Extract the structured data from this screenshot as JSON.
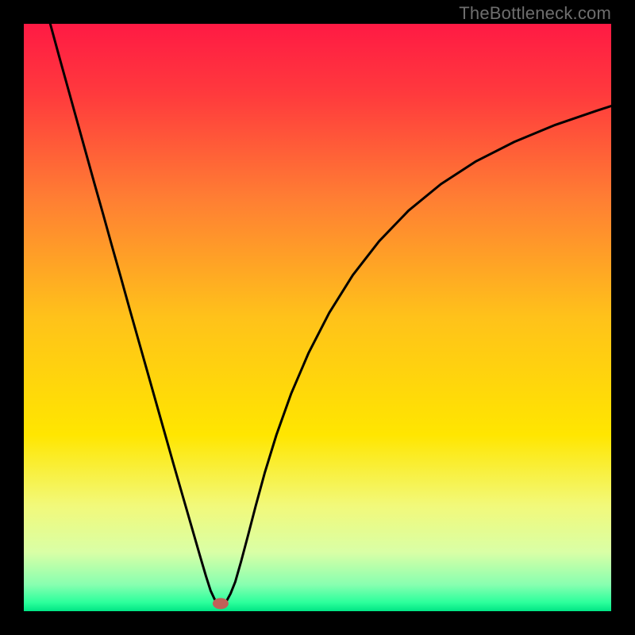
{
  "watermark": "TheBottleneck.com",
  "chart_data": {
    "type": "line",
    "title": "",
    "xlabel": "",
    "ylabel": "",
    "xlim": [
      0,
      1
    ],
    "ylim": [
      0,
      1
    ],
    "grid": false,
    "legend": false,
    "background_gradient": {
      "stops": [
        {
          "pos": 0.0,
          "color": "#ff1a44"
        },
        {
          "pos": 0.12,
          "color": "#ff3a3d"
        },
        {
          "pos": 0.3,
          "color": "#ff7f33"
        },
        {
          "pos": 0.5,
          "color": "#ffc21a"
        },
        {
          "pos": 0.7,
          "color": "#ffe600"
        },
        {
          "pos": 0.82,
          "color": "#f2f97a"
        },
        {
          "pos": 0.9,
          "color": "#d9ffa6"
        },
        {
          "pos": 0.955,
          "color": "#87ffb0"
        },
        {
          "pos": 0.985,
          "color": "#2cff9c"
        },
        {
          "pos": 1.0,
          "color": "#00e585"
        }
      ]
    },
    "marker": {
      "x": 0.335,
      "y": 0.013,
      "color": "#c06058",
      "rx": 10,
      "ry": 7
    },
    "series": [
      {
        "name": "bottleneck-curve",
        "color": "#000000",
        "width": 3,
        "x": [
          0.045,
          0.06,
          0.075,
          0.09,
          0.105,
          0.12,
          0.135,
          0.15,
          0.165,
          0.18,
          0.195,
          0.21,
          0.225,
          0.24,
          0.255,
          0.27,
          0.285,
          0.3,
          0.31,
          0.318,
          0.325,
          0.33,
          0.335,
          0.34,
          0.345,
          0.352,
          0.36,
          0.37,
          0.382,
          0.395,
          0.41,
          0.43,
          0.455,
          0.485,
          0.52,
          0.56,
          0.605,
          0.655,
          0.71,
          0.77,
          0.835,
          0.905,
          0.975,
          1.0
        ],
        "y": [
          1.0,
          0.945,
          0.891,
          0.837,
          0.783,
          0.729,
          0.676,
          0.622,
          0.569,
          0.515,
          0.462,
          0.409,
          0.356,
          0.303,
          0.25,
          0.198,
          0.146,
          0.094,
          0.06,
          0.035,
          0.02,
          0.012,
          0.009,
          0.011,
          0.017,
          0.03,
          0.05,
          0.085,
          0.13,
          0.18,
          0.235,
          0.3,
          0.37,
          0.44,
          0.508,
          0.572,
          0.63,
          0.682,
          0.727,
          0.766,
          0.799,
          0.828,
          0.852,
          0.86
        ]
      }
    ]
  }
}
